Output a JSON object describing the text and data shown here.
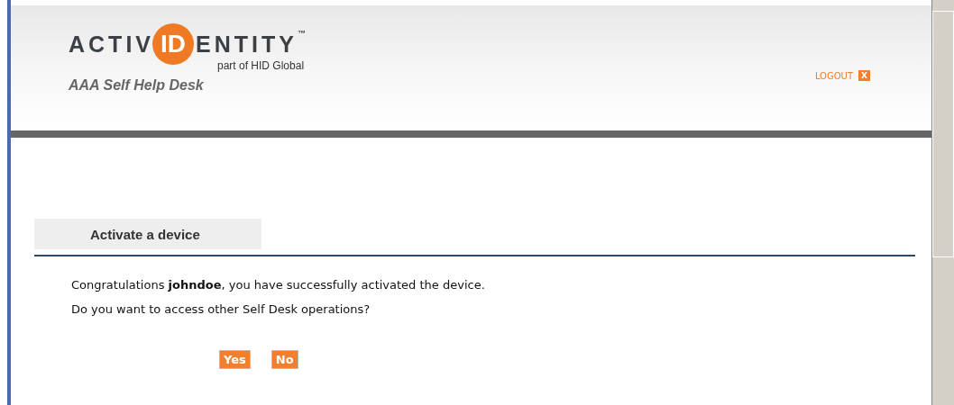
{
  "header": {
    "logo": {
      "left": "ACTIV",
      "mark": "ID",
      "right": "ENTITY",
      "trademark": "™",
      "tagline": "part of HID Global"
    },
    "app_title": "AAA Self Help Desk",
    "logout": {
      "label": "LOGOUT",
      "icon": "X"
    }
  },
  "section_tab": {
    "label": "Activate a device"
  },
  "messages": [
    "Congratulations **johndoe**, you have successfully activated the device.",
    "Do you want to access other Self Desk operations?"
  ],
  "buttons": [
    "Yes",
    "No"
  ]
}
